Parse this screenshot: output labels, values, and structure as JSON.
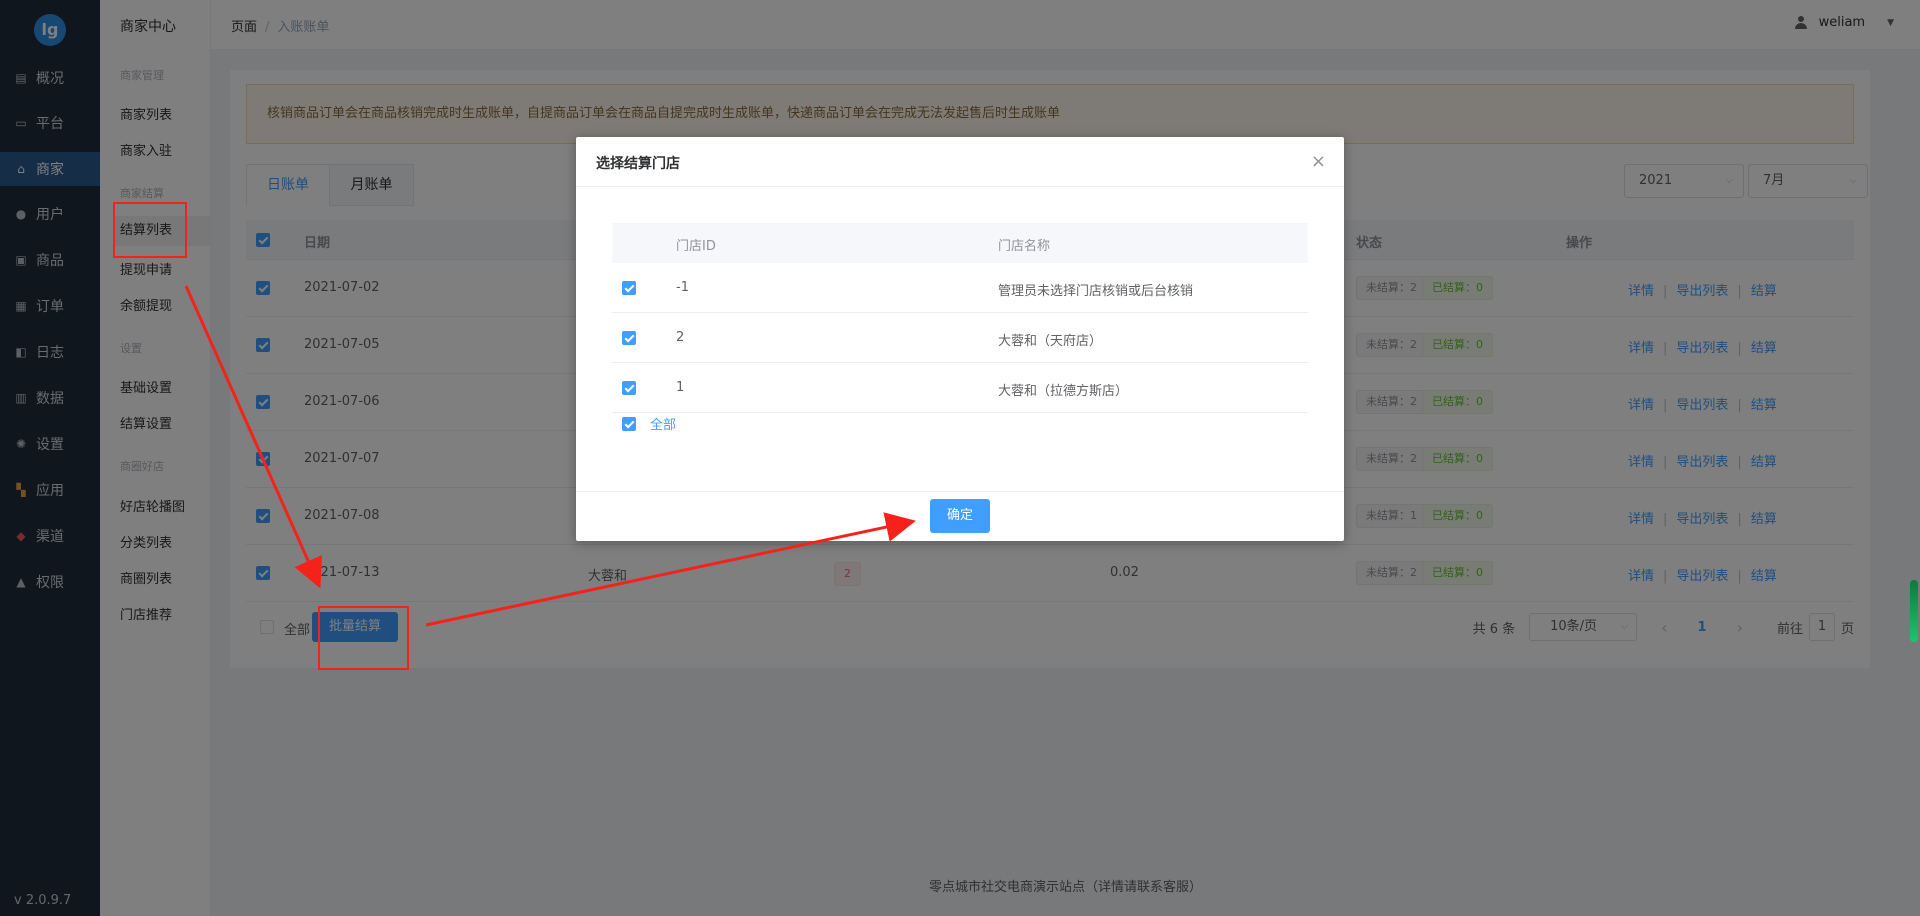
{
  "app": {
    "logo_text": "lg",
    "version": "v 2.0.9.7"
  },
  "nav": {
    "items": [
      {
        "label": "概况",
        "icon": "dashboard-icon"
      },
      {
        "label": "平台",
        "icon": "monitor-icon"
      },
      {
        "label": "商家",
        "icon": "store-icon",
        "active": true
      },
      {
        "label": "用户",
        "icon": "user-icon"
      },
      {
        "label": "商品",
        "icon": "goods-icon"
      },
      {
        "label": "订单",
        "icon": "order-icon"
      },
      {
        "label": "日志",
        "icon": "log-icon"
      },
      {
        "label": "数据",
        "icon": "chart-icon"
      },
      {
        "label": "设置",
        "icon": "gear-icon"
      },
      {
        "label": "应用",
        "icon": "apps-icon"
      },
      {
        "label": "渠道",
        "icon": "cube-icon"
      },
      {
        "label": "权限",
        "icon": "lock-icon"
      }
    ]
  },
  "submenu": {
    "title": "商家中心",
    "group1": "商家管理",
    "link_list": "商家列表",
    "link_join": "商家入驻",
    "group2": "商家结算",
    "link_settle": "结算列表",
    "link_withdraw": "提现申请",
    "link_balance": "余额提现",
    "group3": "设置",
    "link_basic": "基础设置",
    "link_settle_set": "结算设置",
    "group4": "商圈好店",
    "link_banner": "好店轮播图",
    "link_category": "分类列表",
    "link_circle": "商圈列表",
    "link_recommend": "门店推荐"
  },
  "header": {
    "crumb_root": "页面",
    "crumb_sep": "/",
    "crumb_current": "入账账单",
    "username": "weliam",
    "caret": "▼"
  },
  "notice": "核销商品订单会在商品核销完成时生成账单，自提商品订单会在商品自提完成时生成账单，快递商品订单会在完成无法发起售后时生成账单",
  "tabs": {
    "daily": "日账单",
    "monthly": "月账单"
  },
  "filters": {
    "year": "2021",
    "month": "7月"
  },
  "table": {
    "col_date": "日期",
    "col_status": "状态",
    "col_ops": "操作",
    "rows": [
      {
        "date": "2021-07-02",
        "unsettled": "未结算：2",
        "settled": "已结算：0"
      },
      {
        "date": "2021-07-05",
        "unsettled": "未结算：2",
        "settled": "已结算：0"
      },
      {
        "date": "2021-07-06",
        "unsettled": "未结算：2",
        "settled": "已结算：0"
      },
      {
        "date": "2021-07-07",
        "unsettled": "未结算：2",
        "settled": "已结算：0"
      },
      {
        "date": "2021-07-08",
        "unsettled": "未结算：1",
        "settled": "已结算：0"
      },
      {
        "date": "2021-07-13",
        "store": "大蓉和",
        "count": "2",
        "amount": "0.02",
        "unsettled": "未结算：2",
        "settled": "已结算：0"
      }
    ],
    "op_detail": "详情",
    "op_export": "导出列表",
    "op_settle": "结算"
  },
  "footer": {
    "select_all": "全部",
    "batch_button": "批量结算",
    "total": "共 6 条",
    "page_size": "10条/页",
    "prev": "‹",
    "page": "1",
    "next": "›",
    "goto_prefix": "前往",
    "goto_value": "1",
    "goto_suffix": "页"
  },
  "copyright": "零点城市社交电商演示站点（详情请联系客服）",
  "dialog": {
    "title": "选择结算门店",
    "close": "×",
    "col_id": "门店ID",
    "col_name": "门店名称",
    "rows": [
      {
        "id": "-1",
        "name": "管理员未选择门店核销或后台核销"
      },
      {
        "id": "2",
        "name": "大蓉和（天府店）"
      },
      {
        "id": "1",
        "name": "大蓉和（拉德方斯店）"
      }
    ],
    "select_all": "全部",
    "confirm": "确定"
  },
  "colors": {
    "primary": "#409eff",
    "annotation": "#f5221b",
    "nav_bg": "#1f2d3d"
  }
}
